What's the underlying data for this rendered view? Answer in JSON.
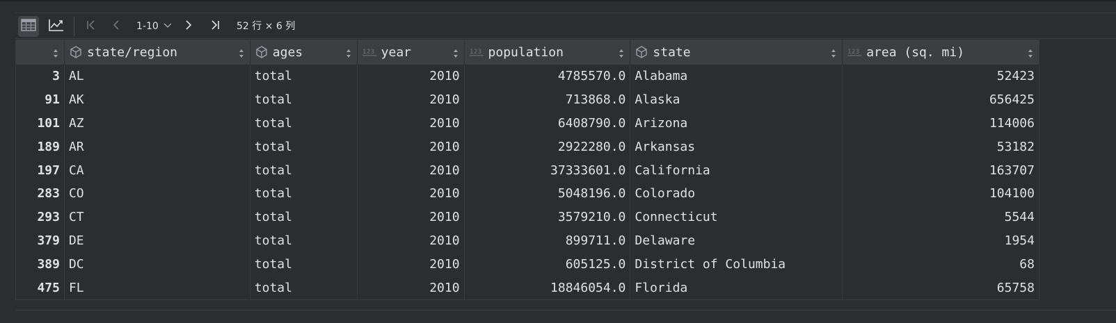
{
  "toolbar": {
    "table_view_icon": "table-icon",
    "chart_view_icon": "chart-icon",
    "first_page_icon": "first-page-icon",
    "prev_page_icon": "prev-page-icon",
    "page_range": "1-10",
    "next_page_icon": "next-page-icon",
    "last_page_icon": "last-page-icon",
    "dimensions": "52 行 × 6 列"
  },
  "columns": [
    {
      "label": "",
      "type_icon": "sort-only"
    },
    {
      "label": "state/region",
      "type_icon": "object-icon"
    },
    {
      "label": "ages",
      "type_icon": "object-icon"
    },
    {
      "label": "year",
      "type_icon": "numeric-icon"
    },
    {
      "label": "population",
      "type_icon": "numeric-icon"
    },
    {
      "label": "state",
      "type_icon": "object-icon"
    },
    {
      "label": "area (sq. mi)",
      "type_icon": "numeric-icon"
    }
  ],
  "rows": [
    {
      "idx": "3",
      "region": "AL",
      "ages": "total",
      "year": "2010",
      "population": "4785570.0",
      "state": "Alabama",
      "area": "52423"
    },
    {
      "idx": "91",
      "region": "AK",
      "ages": "total",
      "year": "2010",
      "population": "713868.0",
      "state": "Alaska",
      "area": "656425"
    },
    {
      "idx": "101",
      "region": "AZ",
      "ages": "total",
      "year": "2010",
      "population": "6408790.0",
      "state": "Arizona",
      "area": "114006"
    },
    {
      "idx": "189",
      "region": "AR",
      "ages": "total",
      "year": "2010",
      "population": "2922280.0",
      "state": "Arkansas",
      "area": "53182"
    },
    {
      "idx": "197",
      "region": "CA",
      "ages": "total",
      "year": "2010",
      "population": "37333601.0",
      "state": "California",
      "area": "163707"
    },
    {
      "idx": "283",
      "region": "CO",
      "ages": "total",
      "year": "2010",
      "population": "5048196.0",
      "state": "Colorado",
      "area": "104100"
    },
    {
      "idx": "293",
      "region": "CT",
      "ages": "total",
      "year": "2010",
      "population": "3579210.0",
      "state": "Connecticut",
      "area": "5544"
    },
    {
      "idx": "379",
      "region": "DE",
      "ages": "total",
      "year": "2010",
      "population": "899711.0",
      "state": "Delaware",
      "area": "1954"
    },
    {
      "idx": "389",
      "region": "DC",
      "ages": "total",
      "year": "2010",
      "population": "605125.0",
      "state": "District of Columbia",
      "area": "68"
    },
    {
      "idx": "475",
      "region": "FL",
      "ages": "total",
      "year": "2010",
      "population": "18846054.0",
      "state": "Florida",
      "area": "65758"
    }
  ],
  "colors": {
    "background": "#2b2d30",
    "header_bg": "#3c3f41",
    "text": "#dfe1e5",
    "border": "#393b40",
    "icon": "#9da0a8"
  }
}
